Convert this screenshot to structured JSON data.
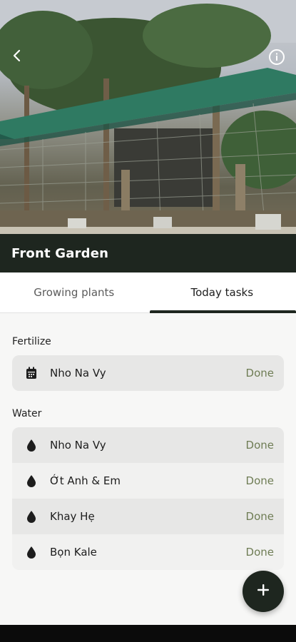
{
  "garden": {
    "name": "Front Garden"
  },
  "tabs": [
    {
      "label": "Growing plants",
      "active": false
    },
    {
      "label": "Today tasks",
      "active": true
    }
  ],
  "sections": [
    {
      "title": "Fertilize",
      "icon": "calendar-icon",
      "tasks": [
        {
          "plant": "Nho Na Vy",
          "status": "Done"
        }
      ]
    },
    {
      "title": "Water",
      "icon": "water-drop-icon",
      "tasks": [
        {
          "plant": "Nho Na Vy",
          "status": "Done"
        },
        {
          "plant": "Ớt Anh & Em",
          "status": "Done"
        },
        {
          "plant": "Khay Hẹ",
          "status": "Done"
        },
        {
          "plant": "Bọn Kale",
          "status": "Done"
        }
      ]
    }
  ],
  "colors": {
    "accent": "#1e261f",
    "status_done": "#6f7d55",
    "row_bg": "#e7e7e6"
  },
  "actions": {
    "add_icon": "plus-icon",
    "info_icon": "info-icon",
    "back_icon": "back-arrow-icon"
  }
}
